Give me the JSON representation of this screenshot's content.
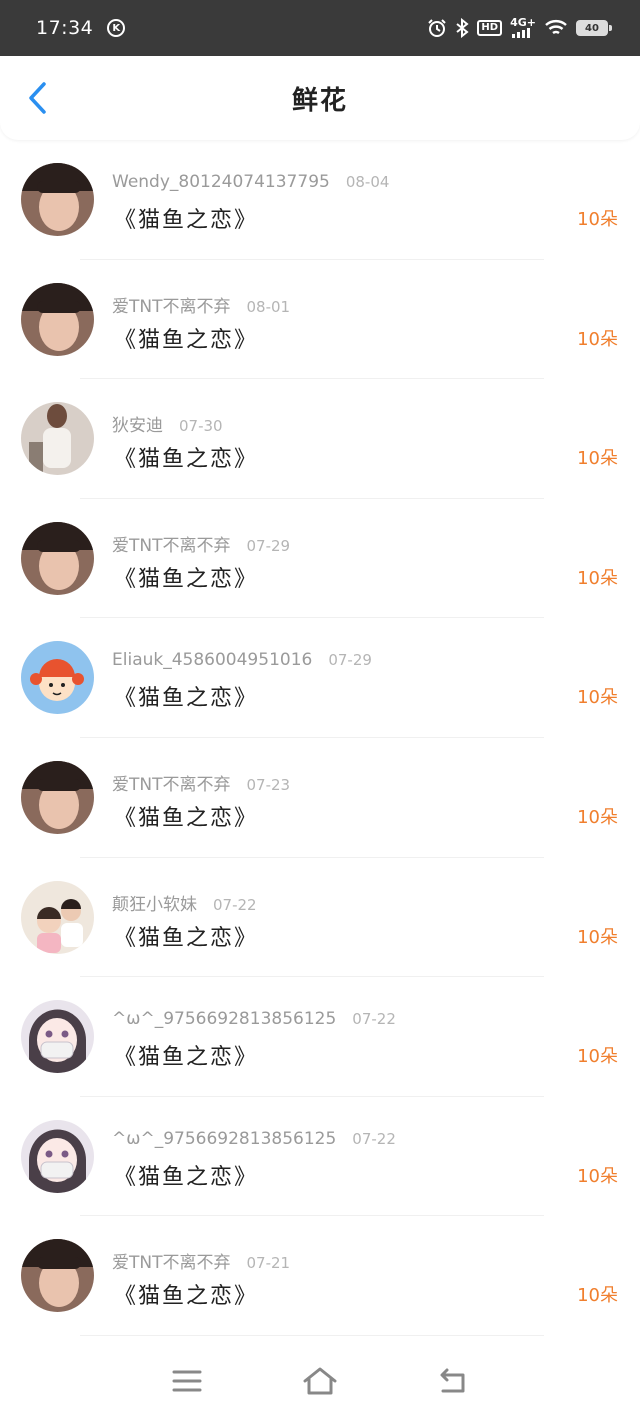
{
  "status": {
    "time": "17:34",
    "k_symbol": "K",
    "hd": "HD",
    "network": "4G+",
    "battery": "40",
    "icons": [
      "alarm-icon",
      "bluetooth-icon",
      "signal-icon",
      "wifi-icon"
    ]
  },
  "header": {
    "title": "鲜花",
    "back_icon": "chevron-left-icon"
  },
  "colors": {
    "accent_back": "#2a8ff0",
    "amount": "#f07f2e",
    "status_bar": "#3a3a3a"
  },
  "items": [
    {
      "user": "Wendy_80124074137795",
      "date": "08-04",
      "book": "《猫鱼之恋》",
      "amount": "10朵",
      "avatar": "photo-boy-avatar"
    },
    {
      "user": "爱TNT不离不弃",
      "date": "08-01",
      "book": "《猫鱼之恋》",
      "amount": "10朵",
      "avatar": "photo-boy-avatar"
    },
    {
      "user": "狄安迪",
      "date": "07-30",
      "book": "《猫鱼之恋》",
      "amount": "10朵",
      "avatar": "photo-girl-avatar"
    },
    {
      "user": "爱TNT不离不弃",
      "date": "07-29",
      "book": "《猫鱼之恋》",
      "amount": "10朵",
      "avatar": "photo-boy-avatar"
    },
    {
      "user": "Eliauk_4586004951016",
      "date": "07-29",
      "book": "《猫鱼之恋》",
      "amount": "10朵",
      "avatar": "cartoon-avatar"
    },
    {
      "user": "爱TNT不离不弃",
      "date": "07-23",
      "book": "《猫鱼之恋》",
      "amount": "10朵",
      "avatar": "photo-boy-avatar"
    },
    {
      "user": "颠狂小软妹",
      "date": "07-22",
      "book": "《猫鱼之恋》",
      "amount": "10朵",
      "avatar": "photo-kids-avatar"
    },
    {
      "user": "^ω^_9756692813856125",
      "date": "07-22",
      "book": "《猫鱼之恋》",
      "amount": "10朵",
      "avatar": "illustration-girl-avatar"
    },
    {
      "user": "^ω^_9756692813856125",
      "date": "07-22",
      "book": "《猫鱼之恋》",
      "amount": "10朵",
      "avatar": "illustration-girl-avatar"
    },
    {
      "user": "爱TNT不离不弃",
      "date": "07-21",
      "book": "《猫鱼之恋》",
      "amount": "10朵",
      "avatar": "photo-boy-avatar"
    }
  ],
  "nav": {
    "icons": [
      "menu-icon",
      "home-icon",
      "back-icon"
    ]
  }
}
